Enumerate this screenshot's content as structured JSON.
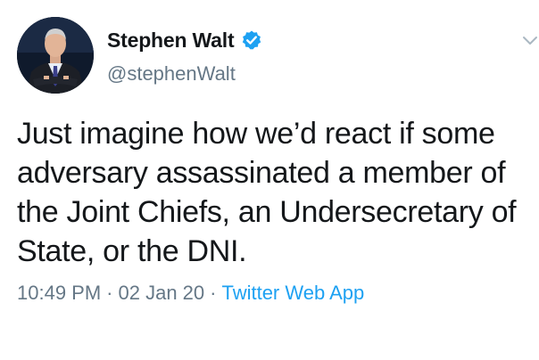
{
  "tweet": {
    "author": {
      "display_name": "Stephen Walt",
      "handle": "@stephenWalt",
      "verified": true,
      "verified_icon": "verified-badge-icon"
    },
    "text": "Just imagine how we’d react if some\nadversary assassinated a member of\nthe Joint Chiefs, an Undersecretary of\nState, or the DNI.",
    "time": "10:49 PM",
    "separator": "·",
    "date": "02 Jan 20",
    "source": "Twitter Web App",
    "menu_icon": "chevron-down-icon"
  },
  "colors": {
    "text_primary": "#14171a",
    "text_secondary": "#657786",
    "accent": "#1da1f2"
  }
}
